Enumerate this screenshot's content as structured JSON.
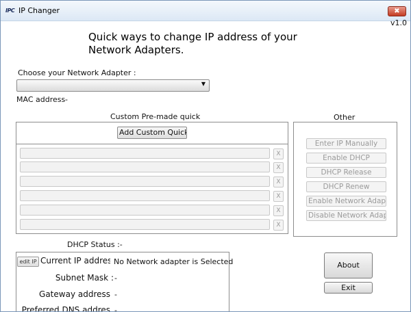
{
  "window": {
    "title": "IP Changer",
    "icon_label": "IPC",
    "close_label": "✖",
    "version": "v1.0"
  },
  "headline": "Quick ways to change IP address of your Network Adapters.",
  "adapter": {
    "label": "Choose your Network Adapter :",
    "selected": "",
    "mac_label": "MAC address",
    "mac_value": "-"
  },
  "quick": {
    "label": "Custom Pre-made quick",
    "add_button": "Add Custom Quick I",
    "slots": [
      "",
      "",
      "",
      "",
      "",
      ""
    ],
    "remove_label": "X"
  },
  "other": {
    "label": "Other",
    "buttons": [
      "Enter IP Manually",
      "Enable DHCP",
      "DHCP Release",
      "DHCP Renew",
      "Enable Network Adapte",
      "Disable Network Adapt"
    ]
  },
  "status": {
    "dhcp_label": "DHCP Status :-",
    "edit_ip_button": "edit IP",
    "current_ip_label": "Current IP addres",
    "current_ip_value": "No Network adapter is Selected",
    "subnet_label": "Subnet Mask :",
    "subnet_value": "-",
    "gateway_label": "Gateway address",
    "gateway_value": "-",
    "dns_label": "Preferred DNS addres",
    "dns_value": "-"
  },
  "actions": {
    "about": "About",
    "exit": "Exit"
  }
}
